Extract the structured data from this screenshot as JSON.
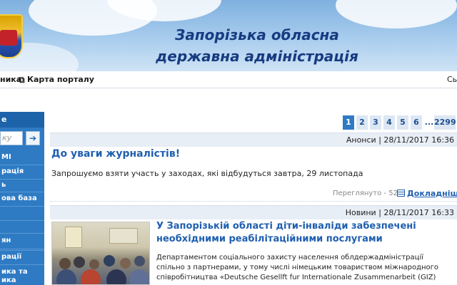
{
  "header": {
    "title_line1": "Запорізька обласна",
    "title_line2": "державна адміністрація"
  },
  "topnav": {
    "left_item": "ника",
    "sitemap_label": "Карта порталу",
    "right_item": "Сь"
  },
  "sidebar": {
    "heading": "e",
    "search_placeholder": "ку",
    "search_button": "➔",
    "items": [
      {
        "label": "МІ"
      },
      {
        "label": "рація"
      },
      {
        "label": "ь"
      },
      {
        "label": "ова база"
      },
      {
        "label": ""
      },
      {
        "label": ""
      },
      {
        "label": "ян"
      },
      {
        "label": ""
      },
      {
        "label": "рації"
      },
      {
        "label": "ика та"
      },
      {
        "label": "ика"
      }
    ]
  },
  "pagination": {
    "pages": [
      "1",
      "2",
      "3",
      "4",
      "5",
      "6",
      "...",
      "2299"
    ],
    "active": "1"
  },
  "news": [
    {
      "category_date": "Анонси | 28/11/2017 16:36",
      "title": "До уваги журналістів!",
      "text": "Запрошуємо взяти участь у заходах, які відбудуться завтра, 29 листопада",
      "views": "Переглянуто - 52",
      "more": "Докладніше"
    },
    {
      "category_date": "Новини | 28/11/2017 16:33",
      "title_line1": "У Запорізькій області діти-інваліди забезпечені",
      "title_line2": "необхідними реабілітаційними послугами",
      "text_line1": "Департаментом соціального захисту населення облдержадміністрації",
      "text_line2": "спільно з партнерами, у тому числі німецьким товариством міжнародного",
      "text_line3": "співробітництва «Deutsche Gesellft fur Internationale Zusammenarbeit (GIZ)"
    }
  ],
  "colors": {
    "accent": "#2e7bc4",
    "title_blue": "#1f5fb0",
    "banner_text": "#173b80"
  }
}
